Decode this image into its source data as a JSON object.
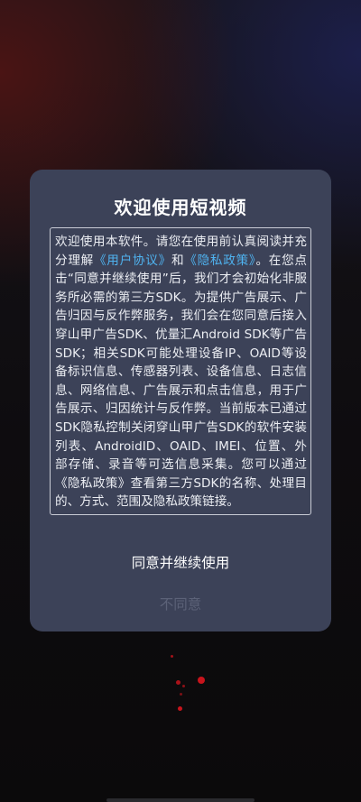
{
  "dialog": {
    "title": "欢迎使用短视频",
    "body": {
      "text_before_links": "欢迎使用本软件。请您在使用前认真阅读并充分理解",
      "user_agreement_link": "《用户协议》",
      "and": "和",
      "privacy_policy_link": "《隐私政策》",
      "text_after_links": "。在您点击“同意并继续使用”后，我们才会初始化非服务所必需的第三方SDK。为提供广告展示、广告归因与反作弊服务，我们会在您同意后接入穿山甲广告SDK、优量汇Android SDK等广告SDK；相关SDK可能处理设备IP、OAID等设备标识信息、传感器列表、设备信息、日志信息、网络信息、广告展示和点击信息，用于广告展示、归因统计与反作弊。当前版本已通过SDK隐私控制关闭穿山甲广告SDK的软件安装列表、AndroidID、OAID、IMEI、位置、外部存储、录音等可选信息采集。您可以通过《隐私政策》查看第三方SDK的名称、处理目的、方式、范围及隐私政策链接。"
    },
    "agree_button": "同意并继续使用",
    "disagree_button": "不同意"
  },
  "colors": {
    "dialog_bg": "#3c4258",
    "link": "#4fb3f0",
    "disagree_text": "#5c6278",
    "loading_dots": "#c8141c"
  }
}
